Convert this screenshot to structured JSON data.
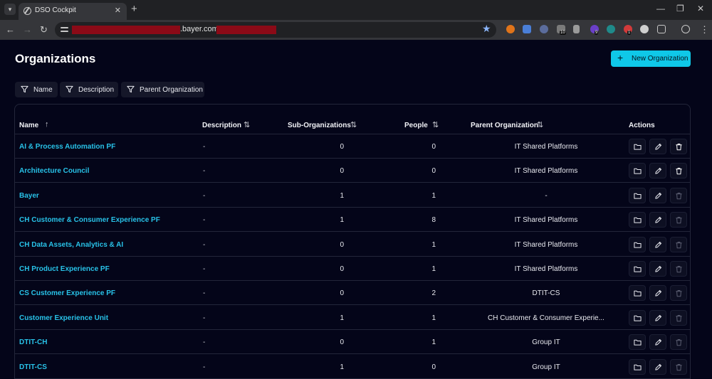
{
  "browser": {
    "tab_title": "DSO Cockpit",
    "tab_close": "✕",
    "new_tab": "+",
    "url_visible": ".bayer.com/",
    "ext_badges": [
      "10",
      "9",
      "1"
    ],
    "win": {
      "minimize": "—",
      "maximize": "❐",
      "close": "✕"
    },
    "nav": {
      "back": "←",
      "forward": "→",
      "reload": "↻"
    }
  },
  "page": {
    "title": "Organizations",
    "new_button": {
      "plus": "+",
      "label": "New Organization"
    }
  },
  "filters": [
    {
      "label": "Name"
    },
    {
      "label": "Description"
    },
    {
      "label": "Parent Organization"
    }
  ],
  "table": {
    "columns": {
      "name": "Name",
      "description": "Description",
      "sub_orgs": "Sub-Organizations",
      "people": "People",
      "parent": "Parent Organization",
      "actions": "Actions"
    },
    "sort_icons": {
      "asc": "↑",
      "both": "⇅"
    },
    "rows": [
      {
        "name": "AI & Process Automation PF",
        "description": "-",
        "sub_orgs": "0",
        "people": "0",
        "parent": "IT Shared Platforms",
        "delete_enabled": true
      },
      {
        "name": "Architecture Council",
        "description": "-",
        "sub_orgs": "0",
        "people": "0",
        "parent": "IT Shared Platforms",
        "delete_enabled": true
      },
      {
        "name": "Bayer",
        "description": "-",
        "sub_orgs": "1",
        "people": "1",
        "parent": "-",
        "delete_enabled": false
      },
      {
        "name": "CH Customer & Consumer Experience PF",
        "description": "-",
        "sub_orgs": "1",
        "people": "8",
        "parent": "IT Shared Platforms",
        "delete_enabled": false
      },
      {
        "name": "CH Data Assets, Analytics & AI",
        "description": "-",
        "sub_orgs": "0",
        "people": "1",
        "parent": "IT Shared Platforms",
        "delete_enabled": false
      },
      {
        "name": "CH Product Experience PF",
        "description": "-",
        "sub_orgs": "0",
        "people": "1",
        "parent": "IT Shared Platforms",
        "delete_enabled": false
      },
      {
        "name": "CS Customer Experience PF",
        "description": "-",
        "sub_orgs": "0",
        "people": "2",
        "parent": "DTIT-CS",
        "delete_enabled": false
      },
      {
        "name": "Customer Experience Unit",
        "description": "-",
        "sub_orgs": "1",
        "people": "1",
        "parent": "CH Customer & Consumer Experie...",
        "delete_enabled": false
      },
      {
        "name": "DTIT-CH",
        "description": "-",
        "sub_orgs": "0",
        "people": "1",
        "parent": "Group IT",
        "delete_enabled": false
      },
      {
        "name": "DTIT-CS",
        "description": "-",
        "sub_orgs": "1",
        "people": "0",
        "parent": "Group IT",
        "delete_enabled": false
      }
    ]
  },
  "colors": {
    "background": "#040519",
    "accent": "#0fc8e8",
    "link": "#28c2e8",
    "delete_enabled": "#ffffff",
    "delete_disabled": "#5a5d70",
    "redaction": "#8b0a17"
  }
}
